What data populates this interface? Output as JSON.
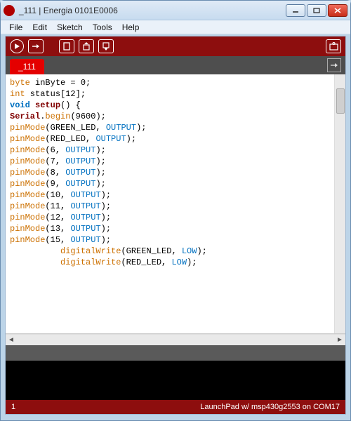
{
  "window": {
    "title": "_111 | Energia 0101E0006"
  },
  "menu": {
    "items": [
      "File",
      "Edit",
      "Sketch",
      "Tools",
      "Help"
    ]
  },
  "toolbar": {
    "icons": [
      "verify",
      "upload",
      "new",
      "open",
      "save",
      "serial-monitor"
    ]
  },
  "tabs": {
    "active": "_111"
  },
  "status": {
    "line": "1",
    "board": "LaunchPad w/ msp430g2553 on COM17"
  },
  "code": {
    "lines": [
      [
        [
          "type",
          "byte"
        ],
        [
          "p",
          " inByte = 0;"
        ]
      ],
      [
        [
          "type",
          "int"
        ],
        [
          "p",
          " status[12];"
        ]
      ],
      [
        [
          "p",
          ""
        ]
      ],
      [
        [
          "ctrl",
          "void"
        ],
        [
          "p",
          " "
        ],
        [
          "setup",
          "setup"
        ],
        [
          "p",
          "() {"
        ]
      ],
      [
        [
          "serial",
          "Serial"
        ],
        [
          "p",
          "."
        ],
        [
          "begin",
          "begin"
        ],
        [
          "p",
          "(9600);"
        ]
      ],
      [
        [
          "func",
          "pinMode"
        ],
        [
          "p",
          "(GREEN_LED, "
        ],
        [
          "const",
          "OUTPUT"
        ],
        [
          "p",
          ");"
        ]
      ],
      [
        [
          "func",
          "pinMode"
        ],
        [
          "p",
          "(RED_LED, "
        ],
        [
          "const",
          "OUTPUT"
        ],
        [
          "p",
          ");"
        ]
      ],
      [
        [
          "p",
          ""
        ]
      ],
      [
        [
          "func",
          "pinMode"
        ],
        [
          "p",
          "(6, "
        ],
        [
          "const",
          "OUTPUT"
        ],
        [
          "p",
          ");"
        ]
      ],
      [
        [
          "func",
          "pinMode"
        ],
        [
          "p",
          "(7, "
        ],
        [
          "const",
          "OUTPUT"
        ],
        [
          "p",
          ");"
        ]
      ],
      [
        [
          "func",
          "pinMode"
        ],
        [
          "p",
          "(8, "
        ],
        [
          "const",
          "OUTPUT"
        ],
        [
          "p",
          ");"
        ]
      ],
      [
        [
          "func",
          "pinMode"
        ],
        [
          "p",
          "(9, "
        ],
        [
          "const",
          "OUTPUT"
        ],
        [
          "p",
          ");"
        ]
      ],
      [
        [
          "func",
          "pinMode"
        ],
        [
          "p",
          "(10, "
        ],
        [
          "const",
          "OUTPUT"
        ],
        [
          "p",
          ");"
        ]
      ],
      [
        [
          "func",
          "pinMode"
        ],
        [
          "p",
          "(11, "
        ],
        [
          "const",
          "OUTPUT"
        ],
        [
          "p",
          ");"
        ]
      ],
      [
        [
          "func",
          "pinMode"
        ],
        [
          "p",
          "(12, "
        ],
        [
          "const",
          "OUTPUT"
        ],
        [
          "p",
          ");"
        ]
      ],
      [
        [
          "func",
          "pinMode"
        ],
        [
          "p",
          "(13, "
        ],
        [
          "const",
          "OUTPUT"
        ],
        [
          "p",
          ");"
        ]
      ],
      [
        [
          "func",
          "pinMode"
        ],
        [
          "p",
          "(15, "
        ],
        [
          "const",
          "OUTPUT"
        ],
        [
          "p",
          ");"
        ]
      ],
      [
        [
          "p",
          "          "
        ],
        [
          "func",
          "digitalWrite"
        ],
        [
          "p",
          "(GREEN_LED, "
        ],
        [
          "const",
          "LOW"
        ],
        [
          "p",
          ");"
        ]
      ],
      [
        [
          "p",
          "          "
        ],
        [
          "func",
          "digitalWrite"
        ],
        [
          "p",
          "(RED_LED, "
        ],
        [
          "const",
          "LOW"
        ],
        [
          "p",
          ");"
        ]
      ]
    ]
  }
}
